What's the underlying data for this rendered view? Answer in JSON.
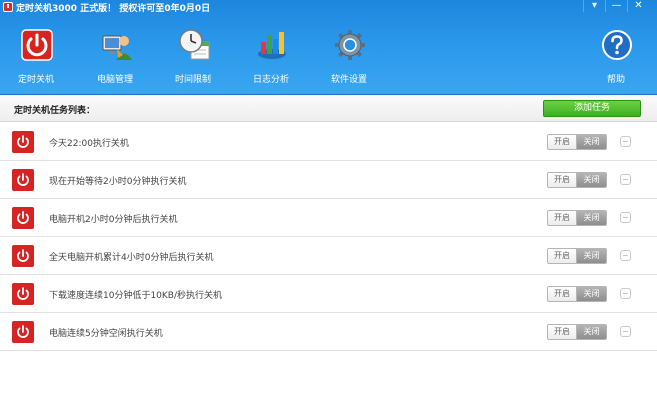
{
  "window": {
    "title": "定时关机3000 正式版！ 授权许可至0年0月0日",
    "controls": [
      "▾",
      "—",
      "✕"
    ]
  },
  "toolbar": {
    "items": [
      {
        "label": "定时关机",
        "icon": "power-icon"
      },
      {
        "label": "电脑管理",
        "icon": "computer-manage-icon"
      },
      {
        "label": "时间限制",
        "icon": "clock-calendar-icon"
      },
      {
        "label": "日志分析",
        "icon": "chart-icon"
      },
      {
        "label": "软件设置",
        "icon": "gear-icon"
      }
    ],
    "help_label": "帮助"
  },
  "list": {
    "title": "定时关机任务列表：",
    "add_button": "添加任务"
  },
  "tasks": [
    {
      "text": "今天22:00执行关机",
      "on_label": "开启",
      "off_label": "关闭"
    },
    {
      "text": "现在开始等待2小时0分钟执行关机",
      "on_label": "开启",
      "off_label": "关闭"
    },
    {
      "text": "电脑开机2小时0分钟后执行关机",
      "on_label": "开启",
      "off_label": "关闭"
    },
    {
      "text": "全天电脑开机累计4小时0分钟后执行关机",
      "on_label": "开启",
      "off_label": "关闭"
    },
    {
      "text": "下载速度连续10分钟低于10KB/秒执行关机",
      "on_label": "开启",
      "off_label": "关闭"
    },
    {
      "text": "电脑连续5分钟空闲执行关机",
      "on_label": "开启",
      "off_label": "关闭"
    }
  ],
  "colors": {
    "header_blue": "#2a98ea",
    "add_green": "#4cbf2a",
    "task_red": "#d42424"
  }
}
